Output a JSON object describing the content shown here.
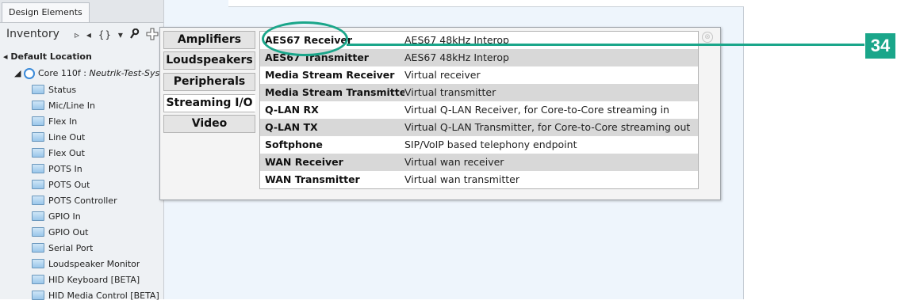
{
  "left_panel": {
    "tab_label": "Design Elements",
    "inventory_label": "Inventory",
    "tools": [
      "▹",
      "◂",
      "{}",
      "▾",
      "key-icon",
      "add-icon"
    ],
    "tree": {
      "root": "Default Location",
      "core_label": "Core 110f : ",
      "core_system": "Neutrik-Test-System",
      "items": [
        "Status",
        "Mic/Line In",
        "Flex In",
        "Line Out",
        "Flex Out",
        "POTS In",
        "POTS Out",
        "POTS Controller",
        "GPIO In",
        "GPIO Out",
        "Serial Port",
        "Loudspeaker Monitor",
        "HID Keyboard [BETA]",
        "HID Media Control [BETA]"
      ]
    }
  },
  "popup": {
    "tabs": [
      "Amplifiers",
      "Loudspeakers",
      "Peripherals",
      "Streaming I/O",
      "Video"
    ],
    "active_tab": "Streaming I/O",
    "items": [
      {
        "name": "AES67 Receiver",
        "desc": "AES67 48kHz Interop"
      },
      {
        "name": "AES67 Transmitter",
        "desc": "AES67 48kHz Interop"
      },
      {
        "name": "Media Stream Receiver",
        "desc": "Virtual receiver"
      },
      {
        "name": "Media Stream Transmitter",
        "desc": "Virtual transmitter"
      },
      {
        "name": "Q-LAN RX",
        "desc": "Virtual Q-LAN Receiver, for Core-to-Core streaming in"
      },
      {
        "name": "Q-LAN TX",
        "desc": "Virtual Q-LAN Transmitter, for Core-to-Core streaming out"
      },
      {
        "name": "Softphone",
        "desc": "SIP/VoIP based telephony endpoint"
      },
      {
        "name": "WAN Receiver",
        "desc": "Virtual wan receiver"
      },
      {
        "name": "WAN Transmitter",
        "desc": "Virtual wan transmitter"
      }
    ],
    "close_glyph": "⊗"
  },
  "callout": {
    "number": "34",
    "color": "#1aa68a"
  }
}
